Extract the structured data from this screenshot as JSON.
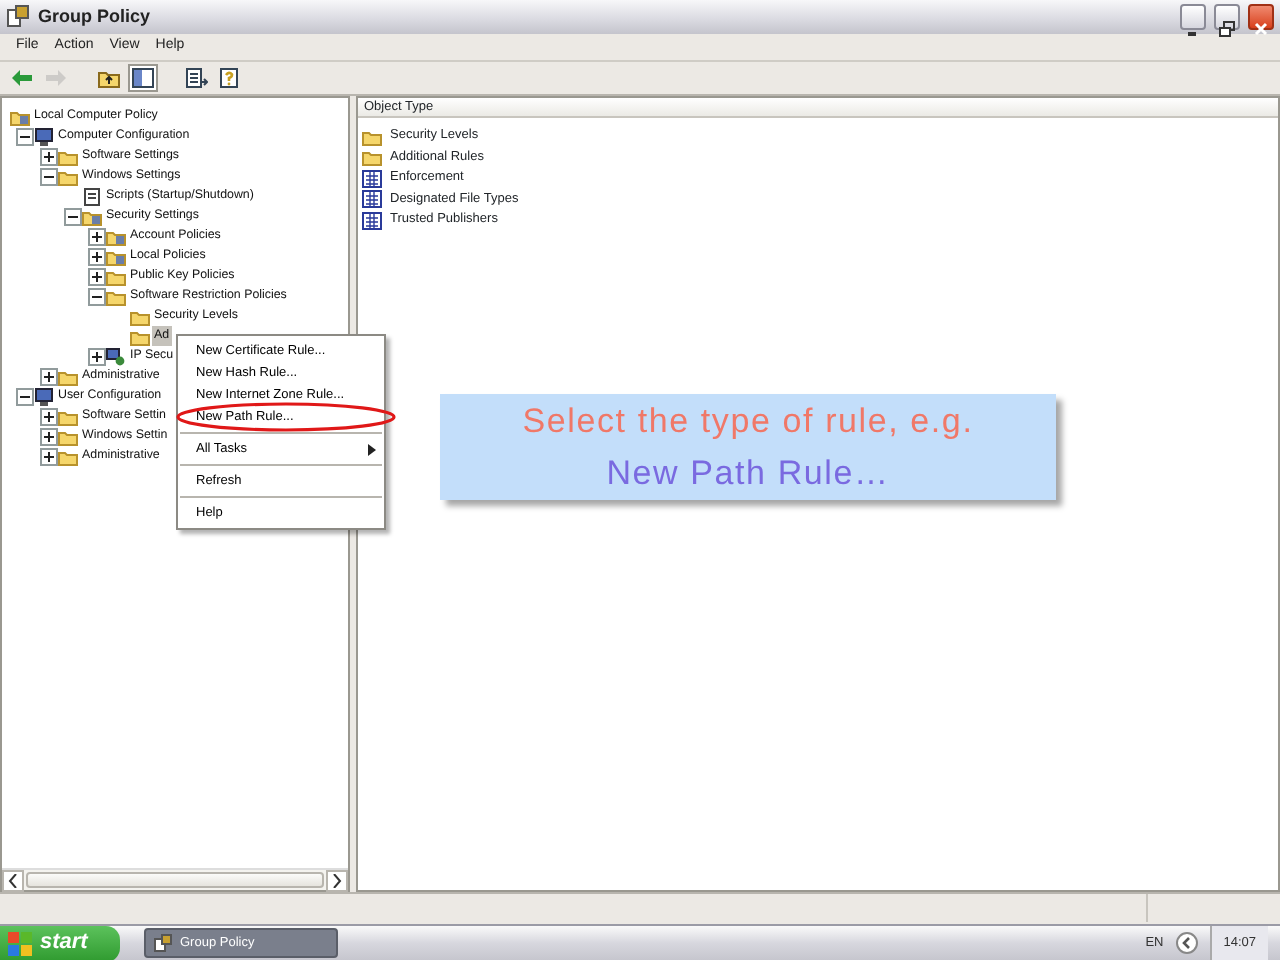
{
  "window": {
    "title": "Group Policy"
  },
  "menu": [
    "File",
    "Action",
    "View",
    "Help"
  ],
  "toolbar": [
    {
      "kind": "back",
      "disabled": false
    },
    {
      "kind": "forward",
      "disabled": true
    },
    {
      "kind": "up",
      "disabled": false
    },
    {
      "kind": "tree",
      "disabled": false
    },
    {
      "kind": "export",
      "disabled": false
    },
    {
      "kind": "help",
      "disabled": false
    }
  ],
  "tree": [
    {
      "label": "Local Computer Policy",
      "kind": "policyfolder",
      "selected": false,
      "children": [
        {
          "label": "Computer Configuration",
          "kind": "computer",
          "expanded": true,
          "selected": false,
          "children": [
            {
              "label": "Software Settings",
              "kind": "folder",
              "expanded": false,
              "selected": false
            },
            {
              "label": "Windows Settings",
              "kind": "folder",
              "expanded": true,
              "selected": false,
              "children": [
                {
                  "label": "Scripts (Startup/Shutdown)",
                  "kind": "script",
                  "selected": false
                },
                {
                  "label": "Security Settings",
                  "kind": "policyfolder",
                  "expanded": true,
                  "selected": false,
                  "children": [
                    {
                      "label": "Account Policies",
                      "kind": "policyfolder",
                      "expanded": false,
                      "selected": false
                    },
                    {
                      "label": "Local Policies",
                      "kind": "policyfolder",
                      "expanded": false,
                      "selected": false
                    },
                    {
                      "label": "Public Key Policies",
                      "kind": "folder",
                      "expanded": false,
                      "selected": false
                    },
                    {
                      "label": "Software Restriction Policies",
                      "kind": "folder",
                      "expanded": true,
                      "selected": false,
                      "children": [
                        {
                          "label": "Security Levels",
                          "kind": "folder",
                          "selected": false
                        },
                        {
                          "label": "Ad",
                          "kind": "folder",
                          "selected": true
                        }
                      ]
                    },
                    {
                      "label": "IP Secu",
                      "kind": "network",
                      "expanded": false,
                      "selected": false
                    }
                  ]
                }
              ]
            },
            {
              "label": "Administrative",
              "kind": "folder",
              "expanded": false,
              "selected": false
            }
          ]
        },
        {
          "label": "User Configuration",
          "kind": "computer",
          "expanded": true,
          "selected": false,
          "children": [
            {
              "label": "Software Settin",
              "kind": "folder",
              "expanded": false,
              "selected": false
            },
            {
              "label": "Windows Settin",
              "kind": "folder",
              "expanded": false,
              "selected": false
            },
            {
              "label": "Administrative",
              "kind": "folder",
              "expanded": false,
              "selected": false
            }
          ]
        }
      ]
    }
  ],
  "list": {
    "column": "Object Type",
    "items": [
      {
        "label": "Security Levels",
        "kind": "folder"
      },
      {
        "label": "Additional Rules",
        "kind": "folder"
      },
      {
        "label": "Enforcement",
        "kind": "policy"
      },
      {
        "label": "Designated File Types",
        "kind": "policy"
      },
      {
        "label": "Trusted Publishers",
        "kind": "policy"
      }
    ]
  },
  "context_menu": [
    {
      "kind": "item",
      "label": "New Certificate Rule..."
    },
    {
      "kind": "item",
      "label": "New Hash Rule..."
    },
    {
      "kind": "item",
      "label": "New Internet Zone Rule..."
    },
    {
      "kind": "item",
      "label": "New Path Rule..."
    },
    {
      "kind": "separator"
    },
    {
      "kind": "submenu",
      "label": "All Tasks"
    },
    {
      "kind": "separator"
    },
    {
      "kind": "item",
      "label": "Refresh"
    },
    {
      "kind": "separator"
    },
    {
      "kind": "item",
      "label": "Help"
    }
  ],
  "callout": {
    "lines": [
      "Select the type of rule, e.g.",
      "New Path Rule…"
    ]
  },
  "taskbar": {
    "start": "start",
    "tasks": [
      {
        "label": "Group Policy",
        "selected": true
      }
    ],
    "language": "EN",
    "clock": "14:07"
  }
}
